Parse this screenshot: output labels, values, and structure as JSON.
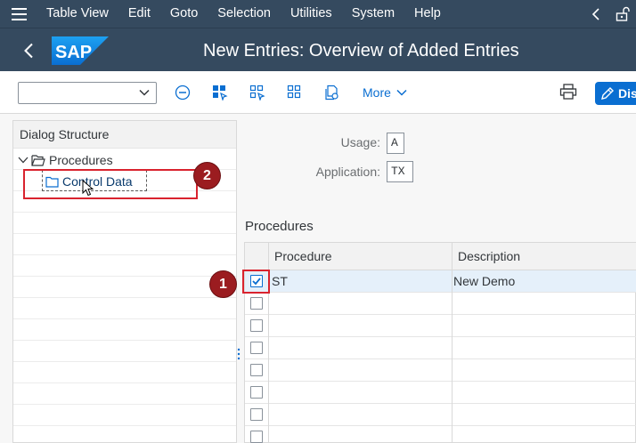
{
  "menu": {
    "items": [
      "Table View",
      "Edit",
      "Goto",
      "Selection",
      "Utilities",
      "System",
      "Help"
    ]
  },
  "title_bar": {
    "logo_text": "SAP",
    "title": "New Entries: Overview of Added Entries"
  },
  "toolbar": {
    "command_field_value": "",
    "more_label": "More",
    "display_label": "Dis",
    "icons": [
      "collapse-icon",
      "select-all-icon",
      "deselect-all-icon",
      "select-block-icon",
      "copy-document-icon",
      "print-icon",
      "display-change-icon"
    ]
  },
  "dialog_structure": {
    "header": "Dialog Structure",
    "nodes": [
      {
        "label": "Procedures",
        "expanded": true,
        "level": 0
      },
      {
        "label": "Control Data",
        "selected": true,
        "level": 1
      }
    ]
  },
  "fields": {
    "usage_label": "Usage:",
    "usage_value": "A",
    "application_label": "Application:",
    "application_value": "TX"
  },
  "procedures": {
    "section_title": "Procedures",
    "columns": [
      "Procedure",
      "Description"
    ],
    "rows": [
      {
        "checked": true,
        "procedure": "ST",
        "description": "New Demo"
      },
      {
        "checked": false,
        "procedure": "",
        "description": ""
      },
      {
        "checked": false,
        "procedure": "",
        "description": ""
      },
      {
        "checked": false,
        "procedure": "",
        "description": ""
      },
      {
        "checked": false,
        "procedure": "",
        "description": ""
      },
      {
        "checked": false,
        "procedure": "",
        "description": ""
      },
      {
        "checked": false,
        "procedure": "",
        "description": ""
      },
      {
        "checked": false,
        "procedure": "",
        "description": ""
      }
    ]
  },
  "annotations": {
    "badge_1": "1",
    "badge_2": "2"
  },
  "colors": {
    "shell": "#354a5f",
    "accent": "#0a6ed1",
    "annotation_red": "#d9232e",
    "badge": "#9b1c20"
  }
}
